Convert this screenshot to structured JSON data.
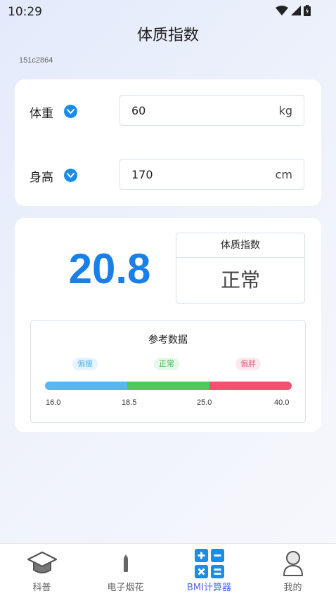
{
  "status_bar": {
    "time": "10:29"
  },
  "header": {
    "title": "体质指数",
    "device_id": "151c2864"
  },
  "inputs": {
    "weight": {
      "label": "体重",
      "value": "60",
      "unit": "kg"
    },
    "height": {
      "label": "身高",
      "value": "170",
      "unit": "cm"
    }
  },
  "result": {
    "bmi": "20.8",
    "status_title": "体质指数",
    "status_value": "正常"
  },
  "reference": {
    "title": "参考数据",
    "tags": [
      "偏瘦",
      "正常",
      "偏胖"
    ],
    "ticks": [
      "16.0",
      "18.5",
      "25.0",
      "40.0"
    ],
    "colors": {
      "thin": "#57b7f5",
      "normal": "#4ec95a",
      "fat": "#f4506f"
    }
  },
  "nav": {
    "items": [
      {
        "label": "科普",
        "icon": "graduation-cap-icon"
      },
      {
        "label": "电子烟花",
        "icon": "firework-stick-icon"
      },
      {
        "label": "BMI计算器",
        "icon": "calculator-icon",
        "active": true
      },
      {
        "label": "我的",
        "icon": "user-icon"
      }
    ],
    "active_color": "#4a6cf7"
  }
}
